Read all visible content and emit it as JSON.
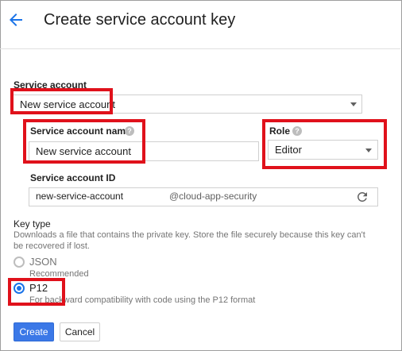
{
  "header": {
    "title": "Create service account key",
    "back_icon": "arrow-left-icon"
  },
  "service_account": {
    "label": "Service account",
    "selected": "New service account"
  },
  "service_account_name": {
    "label": "Service account name",
    "value": "New service account"
  },
  "role": {
    "label": "Role",
    "selected": "Editor"
  },
  "service_account_id": {
    "label": "Service account ID",
    "value": "new-service-account",
    "suffix": "@cloud-app-security"
  },
  "key_type": {
    "label": "Key type",
    "description_line1": "Downloads a file that contains the private key. Store the file securely because this key can't",
    "description_line2": "be recovered if lost.",
    "options": [
      {
        "label": "JSON",
        "sublabel": "Recommended",
        "selected": false
      },
      {
        "label": "P12",
        "sublabel": "For backward compatibility with code using the P12 format",
        "selected": true
      }
    ]
  },
  "actions": {
    "create": "Create",
    "cancel": "Cancel"
  },
  "colors": {
    "accent": "#3b78e7",
    "highlight": "#e0111b"
  }
}
